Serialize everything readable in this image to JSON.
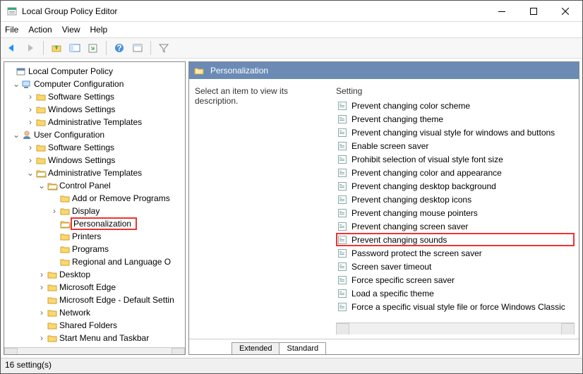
{
  "window": {
    "title": "Local Group Policy Editor"
  },
  "menu": {
    "file": "File",
    "action": "Action",
    "view": "View",
    "help": "Help"
  },
  "tree": {
    "root": "Local Computer Policy",
    "cc": "Computer Configuration",
    "ss1": "Software Settings",
    "ws1": "Windows Settings",
    "at1": "Administrative Templates",
    "uc": "User Configuration",
    "ss2": "Software Settings",
    "ws2": "Windows Settings",
    "at2": "Administrative Templates",
    "cp": "Control Panel",
    "arp": "Add or Remove Programs",
    "disp": "Display",
    "pers": "Personalization",
    "prn": "Printers",
    "prog": "Programs",
    "rlo": "Regional and Language O",
    "desk": "Desktop",
    "me": "Microsoft Edge",
    "med": "Microsoft Edge - Default Settin",
    "net": "Network",
    "sf": "Shared Folders",
    "smt": "Start Menu and Taskbar"
  },
  "panel": {
    "header": "Personalization",
    "desc": "Select an item to view its description.",
    "col": "Setting"
  },
  "settings": [
    "Prevent changing color scheme",
    "Prevent changing theme",
    "Prevent changing visual style for windows and buttons",
    "Enable screen saver",
    "Prohibit selection of visual style font size",
    "Prevent changing color and appearance",
    "Prevent changing desktop background",
    "Prevent changing desktop icons",
    "Prevent changing mouse pointers",
    "Prevent changing screen saver",
    "Prevent changing sounds",
    "Password protect the screen saver",
    "Screen saver timeout",
    "Force specific screen saver",
    "Load a specific theme",
    "Force a specific visual style file or force Windows Classic"
  ],
  "tabs": {
    "ext": "Extended",
    "std": "Standard"
  },
  "status": "16 setting(s)",
  "highlight_index": 10
}
